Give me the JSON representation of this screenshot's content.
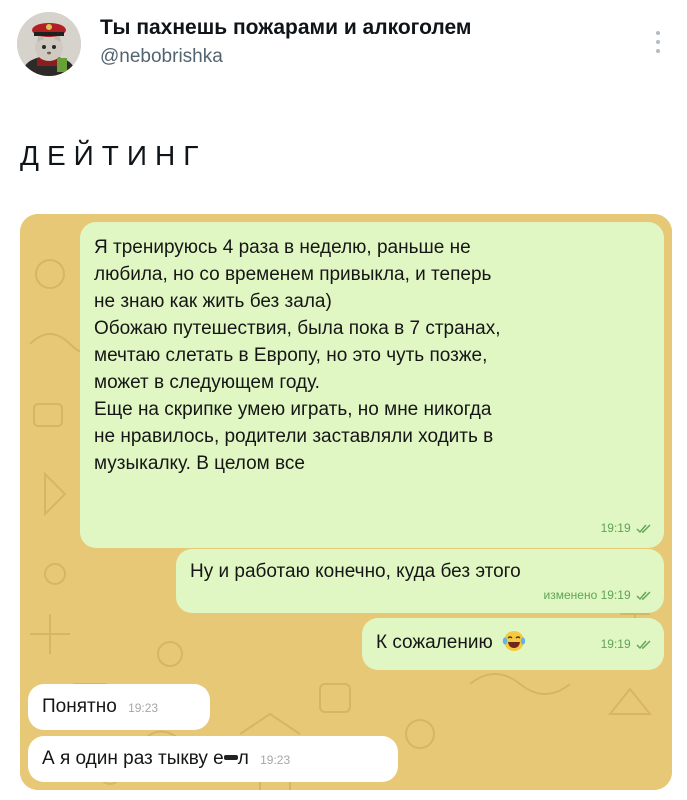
{
  "tweet": {
    "display_name": "Ты пахнешь пожарами и алкоголем",
    "handle": "@nebobrishka",
    "text": "ДЕЙТИНГ",
    "avatar_icon": "avatar-cat-icon",
    "more_icon": "more-vertical-icon"
  },
  "chat": {
    "background_color": "#e6c876",
    "outgoing_color": "#e0f7c4",
    "incoming_color": "#ffffff",
    "messages": [
      {
        "direction": "out",
        "lines": [
          "Я тренируюсь 4 раза в неделю, раньше не",
          "любила, но со временем привыкла, и теперь",
          "не знаю как жить без зала)",
          "Обожаю путешествия, была пока в 7 странах,",
          "мечтаю слетать в Европу, но это чуть позже,",
          "может в следующем году.",
          "Еще на скрипке умею играть, но мне никогда",
          "не нравилось, родители заставляли ходить в",
          "музыкалку. В целом все"
        ],
        "time": "19:19",
        "status": "read"
      },
      {
        "direction": "out",
        "text": "Ну и работаю конечно, куда без этого",
        "edited_label": "изменено",
        "time": "19:19",
        "status": "read"
      },
      {
        "direction": "out",
        "text": "К сожалению",
        "emoji": "crying-laughing-emoji",
        "time": "19:19",
        "status": "read"
      },
      {
        "direction": "in",
        "text": "Понятно",
        "time": "19:23"
      },
      {
        "direction": "in",
        "text": "А я один раз тыкву е",
        "text_end": "л",
        "censor": "censor-sunglasses-icon",
        "time": "19:23"
      }
    ]
  }
}
